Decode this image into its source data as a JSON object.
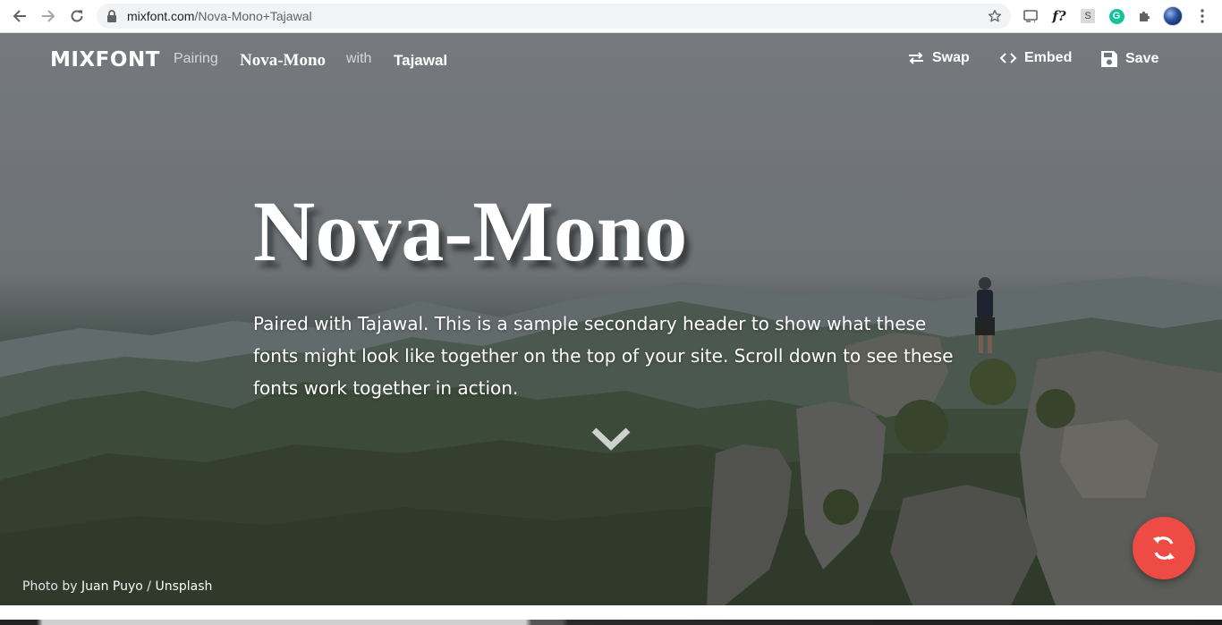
{
  "browser": {
    "url_domain": "mixfont.com",
    "url_path": "/Nova-Mono+Tajawal",
    "extensions": [
      "cast-icon",
      "fontface-ninja-icon",
      "s-extension-icon",
      "grammarly-icon",
      "puzzle-icon"
    ],
    "extension_labels": {
      "fq": "f?",
      "s": "S",
      "g": "G"
    }
  },
  "nav": {
    "logo": "MIXFONT",
    "pairing_label": "Pairing",
    "font1": "Nova-Mono",
    "with_label": "with",
    "font2": "Tajawal",
    "swap_label": "Swap",
    "embed_label": "Embed",
    "save_label": "Save"
  },
  "hero": {
    "headline": "Nova-Mono",
    "subhead": "Paired with Tajawal. This is a sample secondary header to show what these fonts might look like together on the top of your site. Scroll down to see these fonts work together in action.",
    "credit_prefix": "Photo by ",
    "credit_author": "Juan Puyo",
    "credit_sep": " / ",
    "credit_source": "Unsplash"
  },
  "colors": {
    "fab": "#ef4b45",
    "text": "#ffffff"
  }
}
